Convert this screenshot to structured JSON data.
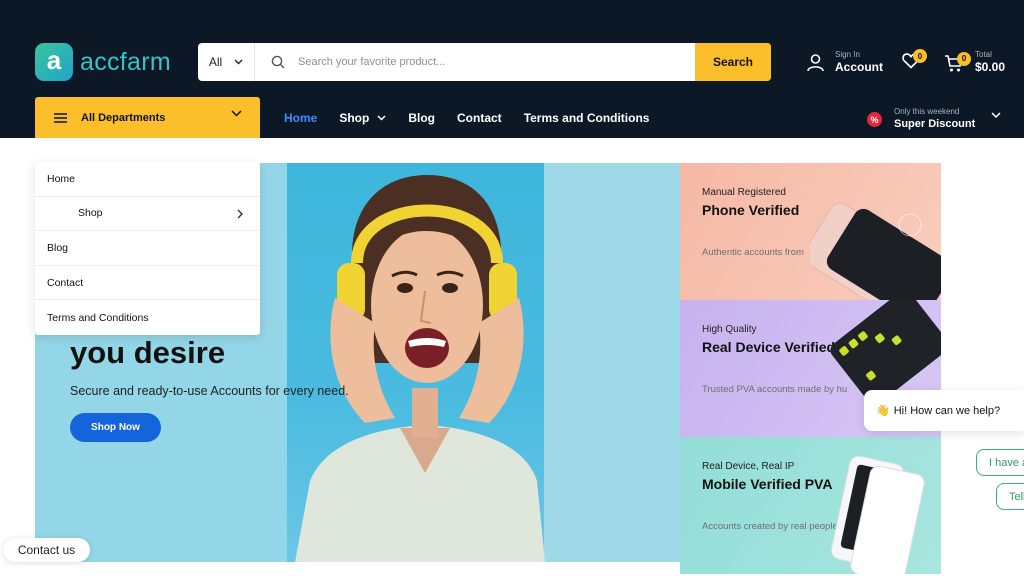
{
  "brand": {
    "logo_letter": "a",
    "name": "accfarm"
  },
  "search": {
    "category": "All",
    "placeholder": "Search your favorite product...",
    "button": "Search"
  },
  "account": {
    "small": "Sign In",
    "label": "Account"
  },
  "wishlist": {
    "count": "0"
  },
  "cart": {
    "count": "0",
    "small": "Total",
    "total": "$0.00"
  },
  "departments": {
    "label": "All Departments"
  },
  "nav": [
    {
      "label": "Home",
      "active": true
    },
    {
      "label": "Shop"
    },
    {
      "label": "Blog"
    },
    {
      "label": "Contact"
    },
    {
      "label": "Terms and Conditions"
    }
  ],
  "promo": {
    "small": "Only this weekend",
    "label": "Super Discount"
  },
  "dropdown": [
    "Home",
    "Shop",
    "Blog",
    "Contact",
    "Terms and Conditions"
  ],
  "hero": {
    "headline": "you desire",
    "subline": "Secure and ready-to-use Accounts for every need.",
    "button": "Shop Now"
  },
  "cards": [
    {
      "kicker": "Manual Registered",
      "title": "Phone Verified",
      "desc": "Authentic accounts from"
    },
    {
      "kicker": "High Quality",
      "title": "Real Device Verified",
      "desc": "Trusted PVA accounts made by hu"
    },
    {
      "kicker": "Real Device, Real IP",
      "title": "Mobile Verified PVA",
      "desc": "Accounts created by real people"
    }
  ],
  "chat": {
    "greeting": "Hi! How can we help?",
    "emoji": "👋",
    "chip1": "I have a",
    "chip2": "Tell"
  },
  "contact": {
    "label": "Contact us"
  },
  "colors": {
    "topbar": "#0d1826",
    "accent_yellow": "#fbbf2c",
    "active_link": "#3d8eff",
    "button_blue": "#1464dc"
  }
}
